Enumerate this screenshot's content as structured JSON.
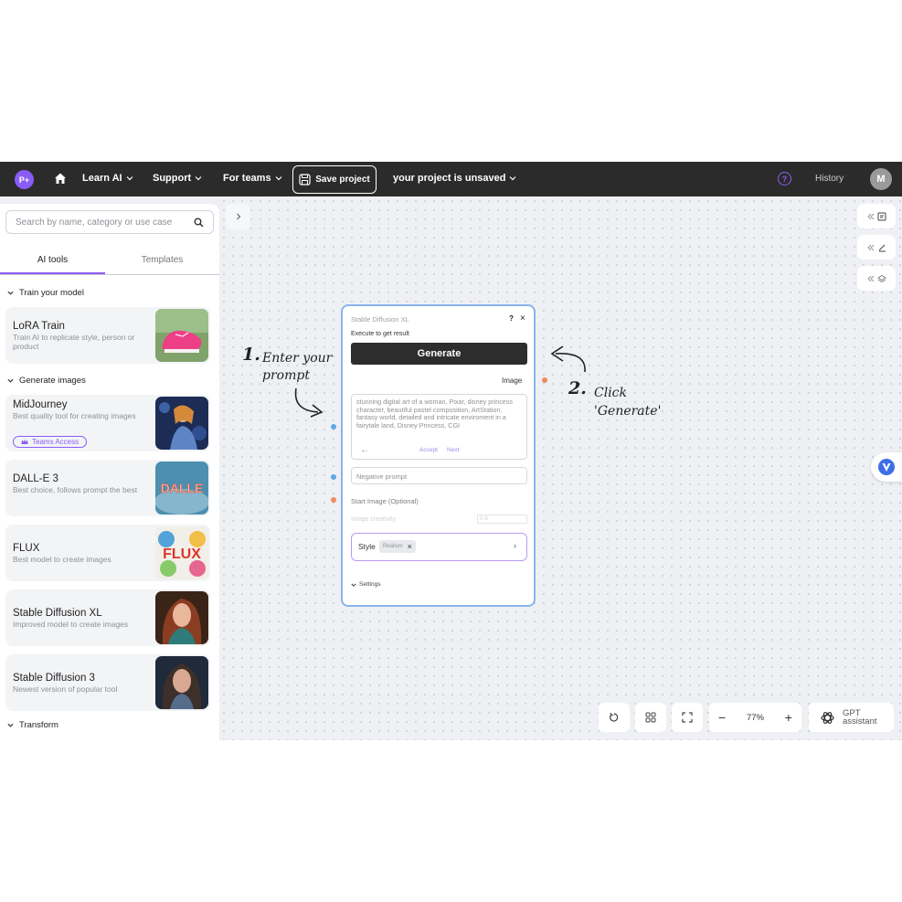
{
  "topbar": {
    "logo_text": "P+",
    "nav": [
      {
        "label": "Learn AI"
      },
      {
        "label": "Support"
      },
      {
        "label": "For teams"
      }
    ],
    "save_label": "Save project",
    "project_status": "your project is unsaved",
    "help_symbol": "?",
    "history_label": "History",
    "avatar_initial": "M"
  },
  "sidebar": {
    "search_placeholder": "Search by name, category or use case",
    "tabs": [
      {
        "label": "AI tools",
        "active": true
      },
      {
        "label": "Templates",
        "active": false
      }
    ],
    "sections": [
      {
        "label": "Train your model"
      },
      {
        "label": "Generate images"
      },
      {
        "label": "Transform"
      }
    ],
    "cards": [
      {
        "title": "LoRA Train",
        "desc": "Train AI to replicate style, person or product",
        "thumb_text": ""
      },
      {
        "title": "MidJourney",
        "desc": "Best quality tool for creating images",
        "badge": "Teams Access",
        "thumb_text": ""
      },
      {
        "title": "DALL-E 3",
        "desc": "Best choice, follows prompt the best",
        "thumb_text": "DALLE"
      },
      {
        "title": "FLUX",
        "desc": "Best model to create images",
        "thumb_text": "FLUX"
      },
      {
        "title": "Stable Diffusion XL",
        "desc": "Improved model to create images",
        "thumb_text": ""
      },
      {
        "title": "Stable Diffusion 3",
        "desc": "Newest version of popular tool",
        "thumb_text": ""
      }
    ]
  },
  "node": {
    "title": "Stable Diffusion XL",
    "help": "?",
    "close": "×",
    "execute_hint": "Execute to get result",
    "generate_label": "Generate",
    "image_label": "Image",
    "prompt_text": "stunning digital art of a woman, Pixar, disney princess character, beautiful pastel composition, ArtStation, fantasy world, detailed and intricate enviroment in a fairytale land, Disney Princess, CGI",
    "back_arrow": "←",
    "accept_label": "Accept",
    "next_label": "Next",
    "negative_placeholder": "Negative prompt",
    "start_image_label": "Start Image (Optional)",
    "creativity_label": "Image creativity",
    "creativity_value": "0.6",
    "style_label": "Style",
    "style_chip": "Realism",
    "style_chip_remove": "×",
    "style_arrow": "›",
    "settings_label": "Settings"
  },
  "annotations": {
    "step1_num": "1.",
    "step1_line1": "Enter your",
    "step1_line2": "prompt",
    "step2_num": "2.",
    "step2_line1": "Click",
    "step2_line2": "'Generate'"
  },
  "toolbar": {
    "zoom_minus": "−",
    "zoom_value": "77%",
    "zoom_plus": "+",
    "gpt_label": "GPT assistant"
  },
  "colors": {
    "accent": "#8a5cf6",
    "topbar_bg": "#2b2b2b",
    "node_border": "#8ab3ee",
    "port_blue": "#5aa9ec",
    "port_orange": "#f08a5d"
  }
}
